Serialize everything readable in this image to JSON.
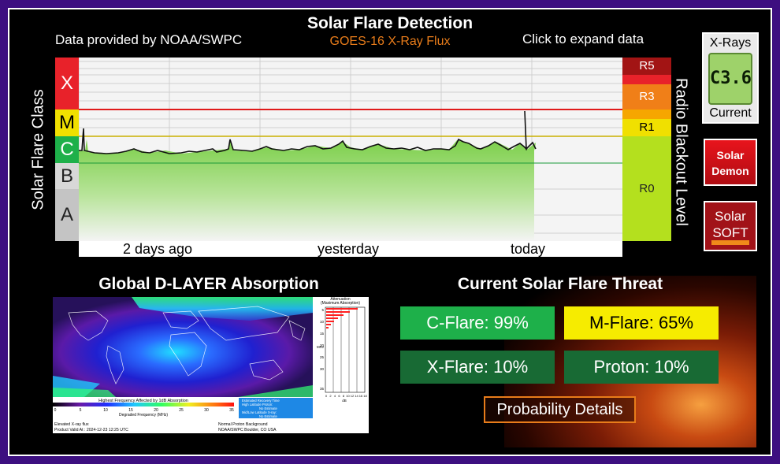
{
  "header": {
    "title": "Solar Flare Detection",
    "subtitle": "GOES-16 X-Ray Flux",
    "credit": "Data provided by NOAA/SWPC",
    "expand_hint": "Click to expand data"
  },
  "flux_chart": {
    "left_axis_label": "Solar Flare Class",
    "right_axis_label": "Radio Blackout Level",
    "classes": [
      "X",
      "M",
      "C",
      "B",
      "A"
    ],
    "radio_levels": [
      "R5",
      "R3",
      "R1",
      "R0"
    ],
    "x_labels": [
      "2 days ago",
      "yesterday",
      "today"
    ]
  },
  "xray_current": {
    "title": "X-Rays",
    "value": "C3.6",
    "footer": "Current"
  },
  "side_buttons": {
    "demon_line1": "Solar",
    "demon_line2": "Demon",
    "soft_line1": "Solar",
    "soft_line2": "SOFT"
  },
  "dlayer": {
    "title": "Global D-LAYER Absorption",
    "legend_title": "Highest Frequency Affected by 1dB Absorption",
    "legend_ticks": [
      "0",
      "5",
      "10",
      "15",
      "20",
      "25",
      "30",
      "35"
    ],
    "legend_axis": "Degraded Frequency (MHz)",
    "status_box": [
      "Estimated Recovery Time",
      "High Latitude Proton:",
      "No Estimate",
      "Mid/Low Latitude X-ray:",
      "No Estimate"
    ],
    "attenuation_title": "Attenuation",
    "attenuation_subtitle": "(Maximum Absorption)",
    "attenuation_axis_y": "MHz",
    "attenuation_axis_x": "dB",
    "attenuation_y_ticks": [
      "5",
      "10",
      "15",
      "20",
      "25",
      "30",
      "35"
    ],
    "attenuation_x_ticks": [
      "0",
      "2",
      "4",
      "6",
      "8",
      "10",
      "12",
      "14",
      "16",
      "18"
    ],
    "footer_left_1": "Elevated X-ray flux",
    "footer_left_2": "Product Valid At : 2024-12-23 12:25 UTC",
    "footer_right_1": "Normal Proton Background",
    "footer_right_2": "NOAA/SWPC Boulder, CO USA"
  },
  "threat": {
    "title": "Current Solar Flare Threat",
    "c_flare": "C-Flare: 99%",
    "m_flare": "M-Flare: 65%",
    "x_flare": "X-Flare: 10%",
    "proton": "Proton: 10%",
    "details_button": "Probability Details"
  }
}
